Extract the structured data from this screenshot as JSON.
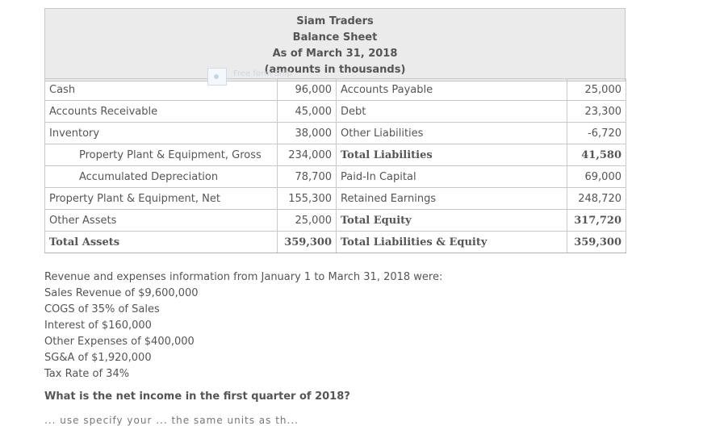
{
  "header": {
    "company": "Siam Traders",
    "statement": "Balance Sheet",
    "date": "As of March 31, 2018",
    "units": "(amounts in thousands)"
  },
  "watermark": "Free form Snip",
  "rows": [
    {
      "left_label": "Cash",
      "left_value": "96,000",
      "right_label": "Accounts Payable",
      "right_value": "25,000"
    },
    {
      "left_label": "Accounts Receivable",
      "left_value": "45,000",
      "right_label": "Debt",
      "right_value": "23,300"
    },
    {
      "left_label": "Inventory",
      "left_value": "38,000",
      "right_label": "Other Liabilities",
      "right_value": "-6,720"
    },
    {
      "left_label": "Property Plant & Equipment, Gross",
      "left_value": "234,000",
      "right_label": "Total Liabilities",
      "right_value": "41,580"
    },
    {
      "left_label": "Accumulated Depreciation",
      "left_value": "78,700",
      "right_label": "Paid-In Capital",
      "right_value": "69,000"
    },
    {
      "left_label": "Property Plant & Equipment, Net",
      "left_value": "155,300",
      "right_label": "Retained Earnings",
      "right_value": "248,720"
    },
    {
      "left_label": "Other Assets",
      "left_value": "25,000",
      "right_label": "Total Equity",
      "right_value": "317,720"
    },
    {
      "left_label": "Total Assets",
      "left_value": "359,300",
      "right_label": "Total Liabilities & Equity",
      "right_value": "359,300"
    }
  ],
  "info": {
    "intro": "Revenue and expenses information from January 1 to March 31, 2018 were:",
    "lines": [
      "Sales Revenue of $9,600,000",
      "COGS of 35% of Sales",
      "Interest of $160,000",
      "Other Expenses of $400,000",
      "SG&A of $1,920,000",
      "Tax Rate of 34%"
    ]
  },
  "question": "What is the net income in the first quarter of 2018?",
  "cut_text": "... use specify your ... the same units as th..."
}
